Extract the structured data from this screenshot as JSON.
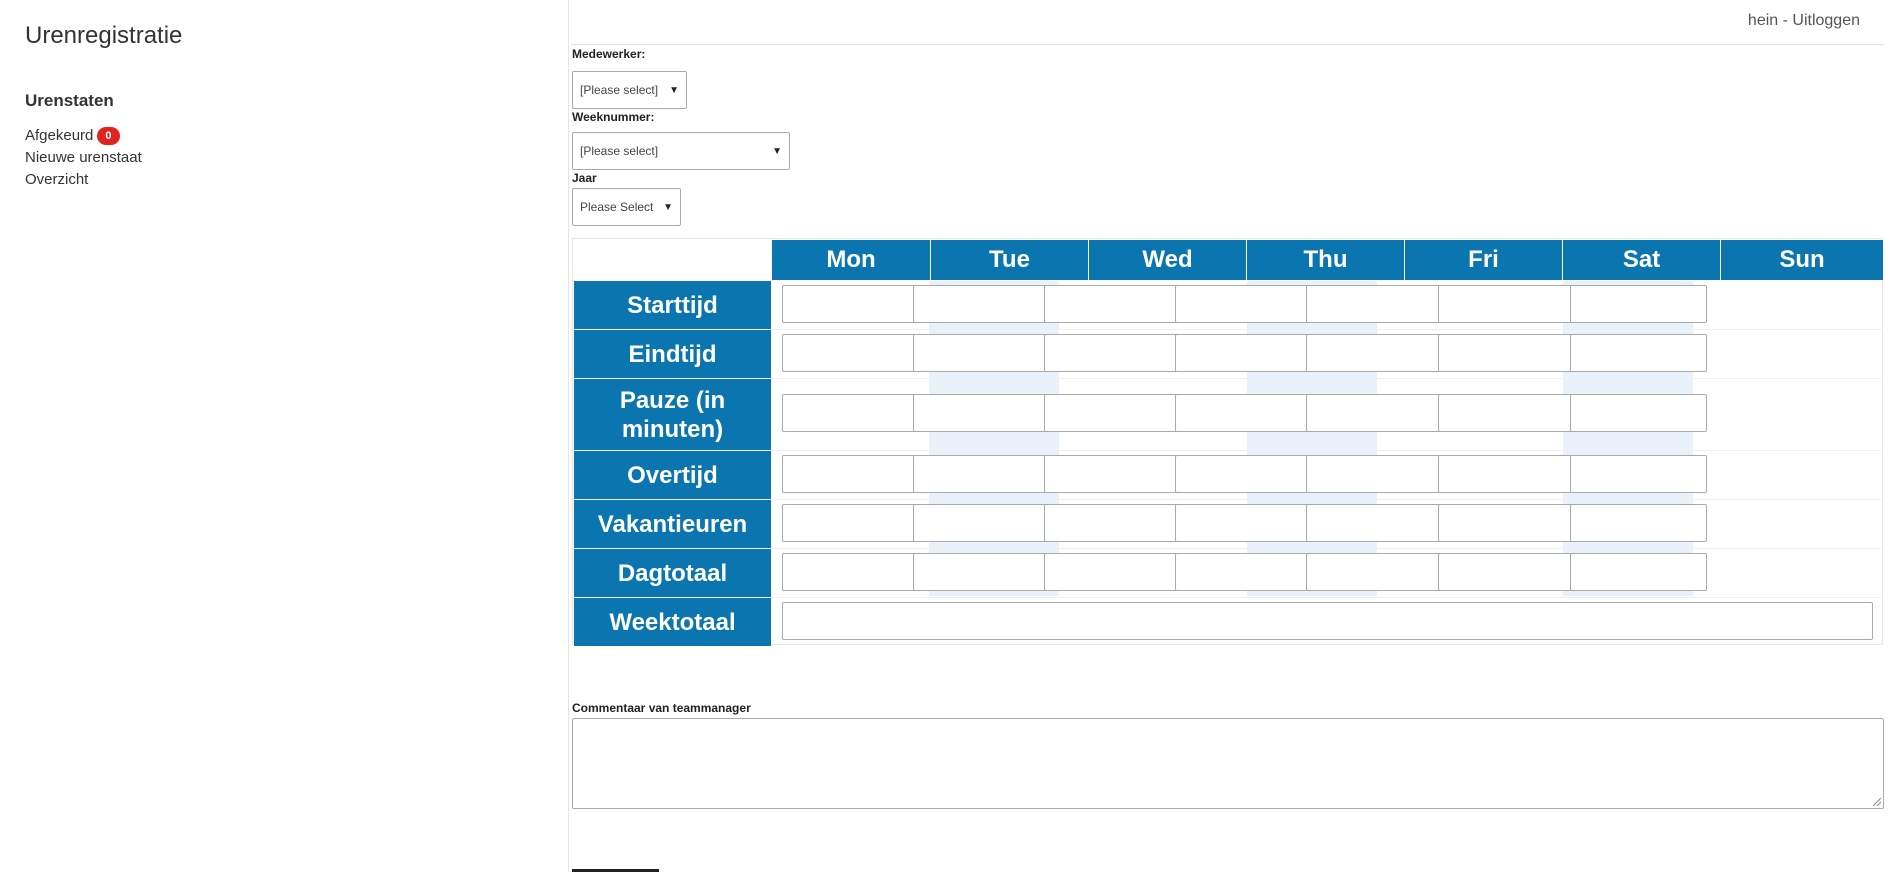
{
  "sidebar": {
    "app_title": "Urenregistratie",
    "section_title": "Urenstaten",
    "items": [
      {
        "label": "Afgekeurd",
        "badge": "0"
      },
      {
        "label": "Nieuwe urenstaat"
      },
      {
        "label": "Overzicht"
      }
    ]
  },
  "header": {
    "user_link": "hein - Uitloggen"
  },
  "form": {
    "employee": {
      "label": "Medewerker:",
      "value": "[Please select]"
    },
    "week": {
      "label": "Weeknummer:",
      "value": "[Please select]"
    },
    "year": {
      "label": "Jaar",
      "value": "Please Select"
    }
  },
  "timesheet": {
    "days": [
      "Mon",
      "Tue",
      "Wed",
      "Thu",
      "Fri",
      "Sat",
      "Sun"
    ],
    "rows": [
      "Starttijd",
      "Eindtijd",
      "Pauze (in minuten)",
      "Overtijd",
      "Vakantieuren",
      "Dagtotaal"
    ],
    "total_label": "Weektotaal"
  },
  "comment": {
    "label": "Commentaar van teammanager"
  },
  "colors": {
    "header_blue": "#0b75b0",
    "badge_red": "#e0231f",
    "column_shade": "#e9f2fb"
  }
}
